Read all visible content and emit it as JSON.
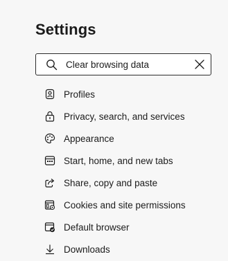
{
  "page": {
    "title": "Settings"
  },
  "search": {
    "value": "Clear browsing data",
    "icon": "search-icon",
    "clear_icon": "close-icon"
  },
  "sidebar": {
    "items": [
      {
        "label": "Profiles",
        "icon": "profile-icon"
      },
      {
        "label": "Privacy, search, and services",
        "icon": "lock-icon"
      },
      {
        "label": "Appearance",
        "icon": "palette-icon"
      },
      {
        "label": "Start, home, and new tabs",
        "icon": "start-page-icon"
      },
      {
        "label": "Share, copy and paste",
        "icon": "share-icon"
      },
      {
        "label": "Cookies and site permissions",
        "icon": "site-permissions-icon"
      },
      {
        "label": "Default browser",
        "icon": "default-browser-icon"
      },
      {
        "label": "Downloads",
        "icon": "download-icon"
      }
    ]
  },
  "colors": {
    "background": "#f7f7f7",
    "text": "#1b1b1b",
    "border": "#2b2b2b"
  }
}
